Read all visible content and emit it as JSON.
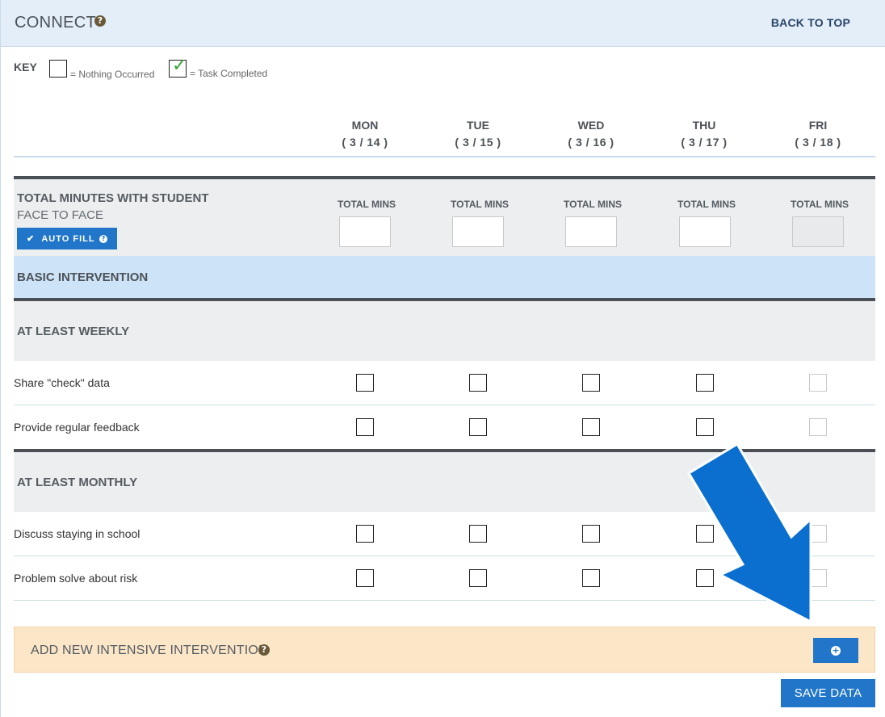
{
  "header": {
    "title": "CONNECT",
    "help_icon": "?",
    "back_to_top": "BACK TO TOP"
  },
  "key": {
    "label": "KEY",
    "nothing_text": "= Nothing Occurred",
    "completed_text": "= Task Completed",
    "check_glyph": "✓"
  },
  "days": [
    {
      "day": "MON",
      "date": "( 3 / 14 )"
    },
    {
      "day": "TUE",
      "date": "( 3 / 15 )"
    },
    {
      "day": "WED",
      "date": "( 3 / 16 )"
    },
    {
      "day": "THU",
      "date": "( 3 / 17 )"
    },
    {
      "day": "FRI",
      "date": "( 3 / 18 )"
    }
  ],
  "total": {
    "title": "TOTAL MINUTES WITH STUDENT",
    "subtitle": "FACE TO FACE",
    "autofill_label": "AUTO FILL",
    "autofill_check": "✔",
    "help_icon": "?",
    "mins_label": "TOTAL MINS",
    "values": [
      "",
      "",
      "",
      "",
      ""
    ]
  },
  "basic": {
    "label": "BASIC INTERVENTION"
  },
  "groups": [
    {
      "title": "AT LEAST WEEKLY",
      "tasks": [
        "Share \"check\" data",
        "Provide regular feedback"
      ]
    },
    {
      "title": "AT LEAST MONTHLY",
      "tasks": [
        "Discuss staying in school",
        "Problem solve about risk"
      ]
    }
  ],
  "add_intensive": {
    "label": "ADD NEW INTENSIVE INTERVENTION",
    "help_icon": "?",
    "plus_glyph": "+"
  },
  "save_label": "SAVE DATA",
  "colors": {
    "accent": "#2176c9",
    "header_bg": "#e3eef9",
    "basic_bg": "#cde3f7",
    "add_bg": "#fce6c8",
    "arrow": "#0a6fcf"
  }
}
